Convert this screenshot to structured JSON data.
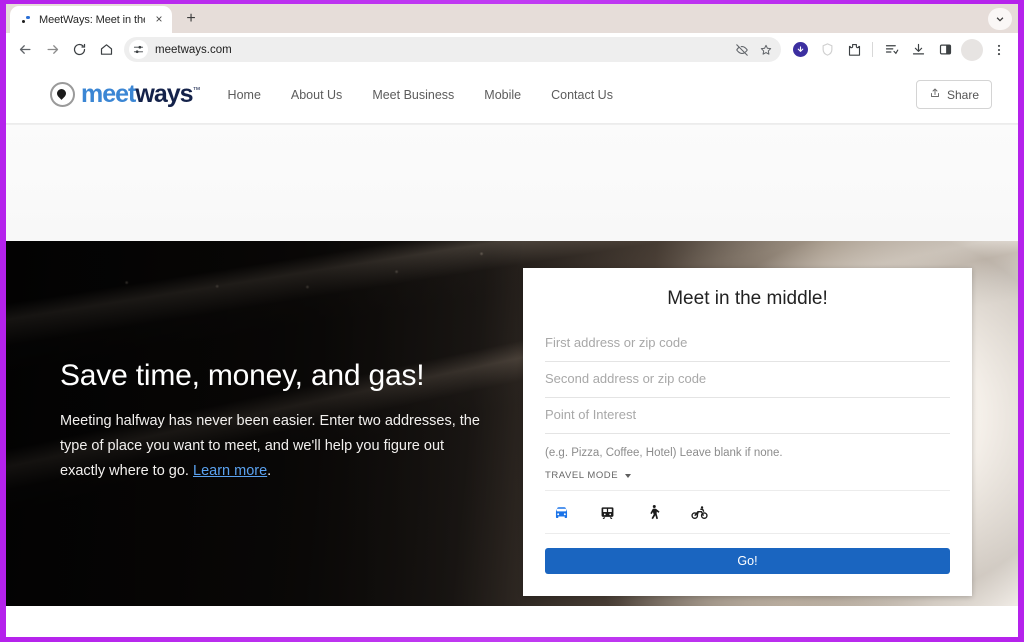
{
  "browser": {
    "tab": {
      "title": "MeetWays: Meet in the Midd",
      "close_label": "×",
      "favicon_name": "meetways-favicon"
    },
    "new_tab_label": "+",
    "toolbar": {
      "back_label": "←",
      "forward_label": "→",
      "reload_label": "↻",
      "home_label": "⌂",
      "url": "meetways.com",
      "site_settings_icon": "tune-icon",
      "hide_icon": "eye-off-icon",
      "bookmark_icon": "star-icon",
      "download_badge_icon": "download-badge-icon",
      "shield_icon": "shield-icon",
      "extensions_icon": "extensions-icon",
      "reading_list_icon": "reading-list-icon",
      "downloads_icon": "downloads-icon",
      "side_panel_icon": "side-panel-icon",
      "profile_icon": "profile-avatar",
      "menu_icon": "three-dot-menu-icon"
    },
    "tab_search_icon": "tab-search-icon"
  },
  "site": {
    "logo": {
      "part1": "meet",
      "part2": "ways",
      "trademark": "™"
    },
    "nav": [
      {
        "label": "Home"
      },
      {
        "label": "About Us"
      },
      {
        "label": "Meet Business"
      },
      {
        "label": "Mobile"
      },
      {
        "label": "Contact Us"
      }
    ],
    "share_button": {
      "label": "Share",
      "icon": "share-icon"
    },
    "hero": {
      "title": "Save time, money, and gas!",
      "paragraph_before": "Meeting halfway has never been easier. Enter two addresses, the type of place you want to meet, and we'll help you figure out exactly where to go. ",
      "link_label": "Learn more",
      "paragraph_after": "."
    },
    "form": {
      "title": "Meet in the middle!",
      "first_address_placeholder": "First address or zip code",
      "second_address_placeholder": "Second address or zip code",
      "poi_placeholder": "Point of Interest",
      "hint": "(e.g. Pizza, Coffee, Hotel) Leave blank if none.",
      "travel_mode_label": "TRAVEL MODE",
      "travel_modes": [
        {
          "name": "driving",
          "icon": "car-icon",
          "selected": true
        },
        {
          "name": "transit",
          "icon": "train-icon",
          "selected": false
        },
        {
          "name": "walking",
          "icon": "walk-icon",
          "selected": false
        },
        {
          "name": "bicycling",
          "icon": "bike-icon",
          "selected": false
        }
      ],
      "submit_label": "Go!"
    }
  },
  "colors": {
    "accent_blue": "#1a65c0",
    "logo_blue": "#3b86d4",
    "logo_navy": "#14224a",
    "link_blue": "#5aa1ef",
    "frame_purple": "#c02ef0"
  }
}
